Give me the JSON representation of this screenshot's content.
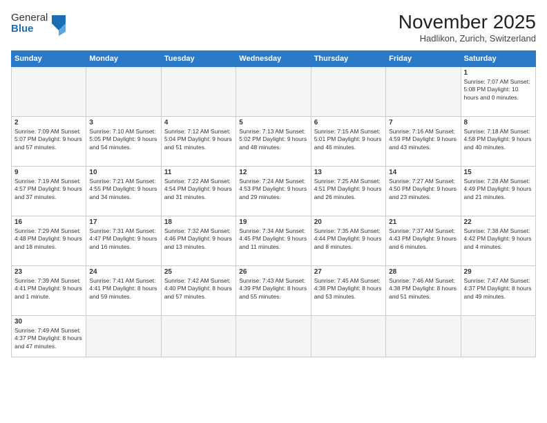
{
  "header": {
    "logo_general": "General",
    "logo_blue": "Blue",
    "month_title": "November 2025",
    "location": "Hadlikon, Zurich, Switzerland"
  },
  "weekdays": [
    "Sunday",
    "Monday",
    "Tuesday",
    "Wednesday",
    "Thursday",
    "Friday",
    "Saturday"
  ],
  "weeks": [
    [
      {
        "day": "",
        "info": ""
      },
      {
        "day": "",
        "info": ""
      },
      {
        "day": "",
        "info": ""
      },
      {
        "day": "",
        "info": ""
      },
      {
        "day": "",
        "info": ""
      },
      {
        "day": "",
        "info": ""
      },
      {
        "day": "1",
        "info": "Sunrise: 7:07 AM\nSunset: 5:08 PM\nDaylight: 10 hours\nand 0 minutes."
      }
    ],
    [
      {
        "day": "2",
        "info": "Sunrise: 7:09 AM\nSunset: 5:07 PM\nDaylight: 9 hours\nand 57 minutes."
      },
      {
        "day": "3",
        "info": "Sunrise: 7:10 AM\nSunset: 5:05 PM\nDaylight: 9 hours\nand 54 minutes."
      },
      {
        "day": "4",
        "info": "Sunrise: 7:12 AM\nSunset: 5:04 PM\nDaylight: 9 hours\nand 51 minutes."
      },
      {
        "day": "5",
        "info": "Sunrise: 7:13 AM\nSunset: 5:02 PM\nDaylight: 9 hours\nand 48 minutes."
      },
      {
        "day": "6",
        "info": "Sunrise: 7:15 AM\nSunset: 5:01 PM\nDaylight: 9 hours\nand 46 minutes."
      },
      {
        "day": "7",
        "info": "Sunrise: 7:16 AM\nSunset: 4:59 PM\nDaylight: 9 hours\nand 43 minutes."
      },
      {
        "day": "8",
        "info": "Sunrise: 7:18 AM\nSunset: 4:58 PM\nDaylight: 9 hours\nand 40 minutes."
      }
    ],
    [
      {
        "day": "9",
        "info": "Sunrise: 7:19 AM\nSunset: 4:57 PM\nDaylight: 9 hours\nand 37 minutes."
      },
      {
        "day": "10",
        "info": "Sunrise: 7:21 AM\nSunset: 4:55 PM\nDaylight: 9 hours\nand 34 minutes."
      },
      {
        "day": "11",
        "info": "Sunrise: 7:22 AM\nSunset: 4:54 PM\nDaylight: 9 hours\nand 31 minutes."
      },
      {
        "day": "12",
        "info": "Sunrise: 7:24 AM\nSunset: 4:53 PM\nDaylight: 9 hours\nand 29 minutes."
      },
      {
        "day": "13",
        "info": "Sunrise: 7:25 AM\nSunset: 4:51 PM\nDaylight: 9 hours\nand 26 minutes."
      },
      {
        "day": "14",
        "info": "Sunrise: 7:27 AM\nSunset: 4:50 PM\nDaylight: 9 hours\nand 23 minutes."
      },
      {
        "day": "15",
        "info": "Sunrise: 7:28 AM\nSunset: 4:49 PM\nDaylight: 9 hours\nand 21 minutes."
      }
    ],
    [
      {
        "day": "16",
        "info": "Sunrise: 7:29 AM\nSunset: 4:48 PM\nDaylight: 9 hours\nand 18 minutes."
      },
      {
        "day": "17",
        "info": "Sunrise: 7:31 AM\nSunset: 4:47 PM\nDaylight: 9 hours\nand 16 minutes."
      },
      {
        "day": "18",
        "info": "Sunrise: 7:32 AM\nSunset: 4:46 PM\nDaylight: 9 hours\nand 13 minutes."
      },
      {
        "day": "19",
        "info": "Sunrise: 7:34 AM\nSunset: 4:45 PM\nDaylight: 9 hours\nand 11 minutes."
      },
      {
        "day": "20",
        "info": "Sunrise: 7:35 AM\nSunset: 4:44 PM\nDaylight: 9 hours\nand 8 minutes."
      },
      {
        "day": "21",
        "info": "Sunrise: 7:37 AM\nSunset: 4:43 PM\nDaylight: 9 hours\nand 6 minutes."
      },
      {
        "day": "22",
        "info": "Sunrise: 7:38 AM\nSunset: 4:42 PM\nDaylight: 9 hours\nand 4 minutes."
      }
    ],
    [
      {
        "day": "23",
        "info": "Sunrise: 7:39 AM\nSunset: 4:41 PM\nDaylight: 9 hours\nand 1 minute."
      },
      {
        "day": "24",
        "info": "Sunrise: 7:41 AM\nSunset: 4:41 PM\nDaylight: 8 hours\nand 59 minutes."
      },
      {
        "day": "25",
        "info": "Sunrise: 7:42 AM\nSunset: 4:40 PM\nDaylight: 8 hours\nand 57 minutes."
      },
      {
        "day": "26",
        "info": "Sunrise: 7:43 AM\nSunset: 4:39 PM\nDaylight: 8 hours\nand 55 minutes."
      },
      {
        "day": "27",
        "info": "Sunrise: 7:45 AM\nSunset: 4:38 PM\nDaylight: 8 hours\nand 53 minutes."
      },
      {
        "day": "28",
        "info": "Sunrise: 7:46 AM\nSunset: 4:38 PM\nDaylight: 8 hours\nand 51 minutes."
      },
      {
        "day": "29",
        "info": "Sunrise: 7:47 AM\nSunset: 4:37 PM\nDaylight: 8 hours\nand 49 minutes."
      }
    ],
    [
      {
        "day": "30",
        "info": "Sunrise: 7:49 AM\nSunset: 4:37 PM\nDaylight: 8 hours\nand 47 minutes."
      },
      {
        "day": "",
        "info": ""
      },
      {
        "day": "",
        "info": ""
      },
      {
        "day": "",
        "info": ""
      },
      {
        "day": "",
        "info": ""
      },
      {
        "day": "",
        "info": ""
      },
      {
        "day": "",
        "info": ""
      }
    ]
  ]
}
